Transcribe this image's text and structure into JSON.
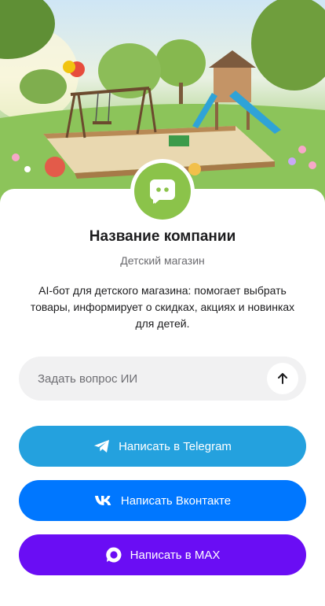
{
  "company": {
    "name": "Название компании",
    "type": "Детский магазин",
    "description": "AI-бот для детского магазина: помогает выбрать товары, информирует о скидках, акциях и новинках для детей."
  },
  "ask": {
    "placeholder": "Задать вопрос ИИ"
  },
  "buttons": {
    "telegram": "Написать в Telegram",
    "vk": "Написать Вконтакте",
    "max": "Написать в MAX"
  },
  "colors": {
    "avatar": "#8bc34a",
    "telegram": "#24a1de",
    "vk": "#0077ff",
    "max": "#6a0df4"
  },
  "icons": {
    "avatar": "chat-bot-icon",
    "send": "arrow-up-icon",
    "telegram": "telegram-icon",
    "vk": "vk-icon",
    "max": "max-icon"
  }
}
